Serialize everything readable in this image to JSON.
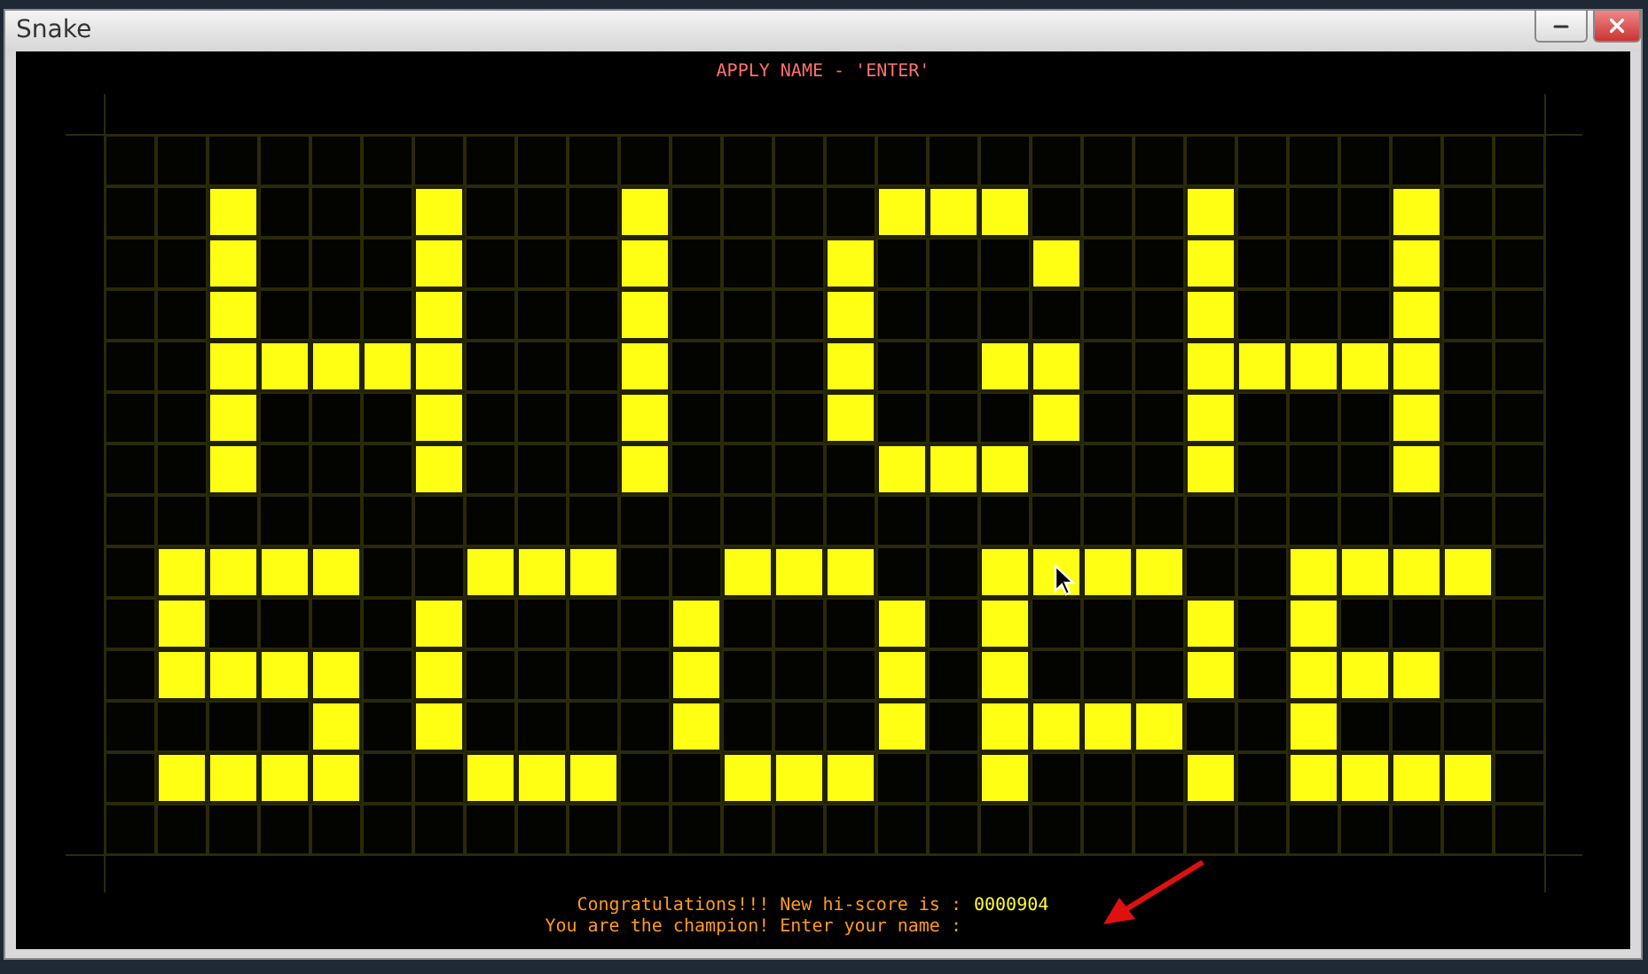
{
  "window": {
    "title": "Snake"
  },
  "prompt": "APPLY NAME - 'ENTER'",
  "board": {
    "rows": [
      [
        false,
        false,
        false,
        false,
        false,
        false,
        false,
        false,
        false,
        false,
        false,
        false,
        false,
        false,
        false,
        false,
        false,
        false,
        false,
        false,
        false,
        false,
        false,
        false,
        false,
        false,
        false,
        false
      ],
      [
        false,
        false,
        true,
        false,
        false,
        false,
        true,
        false,
        false,
        false,
        true,
        false,
        false,
        false,
        false,
        true,
        true,
        true,
        false,
        false,
        false,
        true,
        false,
        false,
        false,
        true,
        false,
        false
      ],
      [
        false,
        false,
        true,
        false,
        false,
        false,
        true,
        false,
        false,
        false,
        true,
        false,
        false,
        false,
        true,
        false,
        false,
        false,
        true,
        false,
        false,
        true,
        false,
        false,
        false,
        true,
        false,
        false
      ],
      [
        false,
        false,
        true,
        false,
        false,
        false,
        true,
        false,
        false,
        false,
        true,
        false,
        false,
        false,
        true,
        false,
        false,
        false,
        false,
        false,
        false,
        true,
        false,
        false,
        false,
        true,
        false,
        false
      ],
      [
        false,
        false,
        true,
        true,
        true,
        true,
        true,
        false,
        false,
        false,
        true,
        false,
        false,
        false,
        true,
        false,
        false,
        true,
        true,
        false,
        false,
        true,
        true,
        true,
        true,
        true,
        false,
        false
      ],
      [
        false,
        false,
        true,
        false,
        false,
        false,
        true,
        false,
        false,
        false,
        true,
        false,
        false,
        false,
        true,
        false,
        false,
        false,
        true,
        false,
        false,
        true,
        false,
        false,
        false,
        true,
        false,
        false
      ],
      [
        false,
        false,
        true,
        false,
        false,
        false,
        true,
        false,
        false,
        false,
        true,
        false,
        false,
        false,
        false,
        true,
        true,
        true,
        false,
        false,
        false,
        true,
        false,
        false,
        false,
        true,
        false,
        false
      ],
      [
        false,
        false,
        false,
        false,
        false,
        false,
        false,
        false,
        false,
        false,
        false,
        false,
        false,
        false,
        false,
        false,
        false,
        false,
        false,
        false,
        false,
        false,
        false,
        false,
        false,
        false,
        false,
        false
      ],
      [
        false,
        true,
        true,
        true,
        true,
        false,
        false,
        true,
        true,
        true,
        false,
        false,
        true,
        true,
        true,
        false,
        false,
        true,
        true,
        true,
        true,
        false,
        false,
        true,
        true,
        true,
        true,
        false
      ],
      [
        false,
        true,
        false,
        false,
        false,
        false,
        true,
        false,
        false,
        false,
        false,
        true,
        false,
        false,
        false,
        true,
        false,
        true,
        false,
        false,
        false,
        true,
        false,
        true,
        false,
        false,
        false,
        false
      ],
      [
        false,
        true,
        true,
        true,
        true,
        false,
        true,
        false,
        false,
        false,
        false,
        true,
        false,
        false,
        false,
        true,
        false,
        true,
        false,
        false,
        false,
        true,
        false,
        true,
        true,
        true,
        false,
        false
      ],
      [
        false,
        false,
        false,
        false,
        true,
        false,
        true,
        false,
        false,
        false,
        false,
        true,
        false,
        false,
        false,
        true,
        false,
        true,
        true,
        true,
        true,
        false,
        false,
        true,
        false,
        false,
        false,
        false
      ],
      [
        false,
        true,
        true,
        true,
        true,
        false,
        false,
        true,
        true,
        true,
        false,
        false,
        true,
        true,
        true,
        false,
        false,
        true,
        false,
        false,
        false,
        true,
        false,
        true,
        true,
        true,
        true,
        false
      ],
      [
        false,
        false,
        false,
        false,
        false,
        false,
        false,
        false,
        false,
        false,
        false,
        false,
        false,
        false,
        false,
        false,
        false,
        false,
        false,
        false,
        false,
        false,
        false,
        false,
        false,
        false,
        false,
        false
      ]
    ]
  },
  "congratulations": {
    "label": "Congratulations!!! New hi-score is :",
    "score": "0000904"
  },
  "name_entry": {
    "label": "You are the champion! Enter your name :"
  }
}
